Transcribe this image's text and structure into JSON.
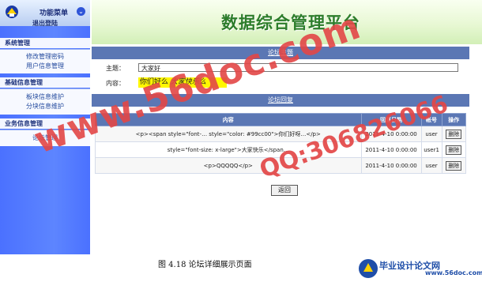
{
  "sidebar": {
    "title": "功能菜单",
    "logout": "退出登陆",
    "groups": [
      {
        "title": "系统管理",
        "items": [
          "修改管理密码",
          "用户信息管理"
        ]
      },
      {
        "title": "基础信息管理",
        "items": [
          "板块信息维护",
          "分块信息维护"
        ]
      },
      {
        "title": "业务信息管理",
        "items": [
          "论坛管理"
        ]
      }
    ]
  },
  "banner": {
    "title": "数据综合管理平台"
  },
  "topic": {
    "section_title": "论坛主题",
    "subject_label": "主题：",
    "subject_value": "大家好",
    "content_label": "内容：",
    "content_part1": "你们好么 ",
    "content_part2": "大家快乐么"
  },
  "replies": {
    "section_title": "论坛回复",
    "headers": [
      "内容",
      "回复日期",
      "帐号",
      "操作"
    ],
    "rows": [
      {
        "content": "<p><span style=\"font-… style=\"color: #99cc00\">你们好呀…</p>",
        "date": "2011-4-10 0:00:00",
        "account": "user",
        "action": "删除"
      },
      {
        "content": "style=\"font-size: x-large\">大家快乐</span…",
        "date": "2011-4-10 0:00:00",
        "account": "user1",
        "action": "删除"
      },
      {
        "content": "<p>QQQQQ</p>",
        "date": "2011-4-10 0:00:00",
        "account": "user",
        "action": "删除"
      }
    ],
    "back_label": "返回"
  },
  "watermarks": {
    "primary": "www.56doc.com",
    "secondary": "QQ:306826066"
  },
  "caption": "图 4.18  论坛详细展示页面",
  "brand": {
    "name": "毕业设计论文网",
    "url": "www.56doc.com"
  }
}
